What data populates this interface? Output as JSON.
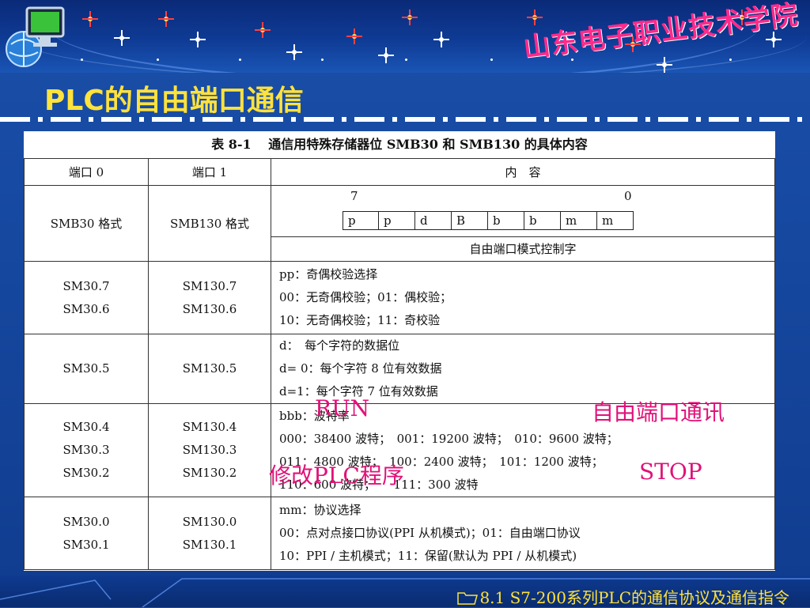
{
  "header": {
    "school_name": "山东电子职业技术学院",
    "title": "PLC的自由端口通信"
  },
  "table": {
    "caption": "表 8-1　 通信用特殊存储器位 SMB30 和 SMB130 的具体内容",
    "headers": [
      "端口 0",
      "端口 1",
      "内　容"
    ],
    "row1": {
      "c1": "SMB30 格式",
      "c2": "SMB130 格式",
      "bit_hi": "7",
      "bit_lo": "0",
      "bits": [
        "p",
        "p",
        "d",
        "B",
        "b",
        "b",
        "m",
        "m"
      ],
      "caption": "自由端口模式控制字"
    },
    "row2": {
      "c1": [
        "SM30.7",
        "SM30.6"
      ],
      "c2": [
        "SM130.7",
        "SM130.6"
      ],
      "content": [
        "pp：奇偶校验选择",
        "00：无奇偶校验；01：偶校验；",
        "10：无奇偶校验；11：奇校验"
      ]
    },
    "row3": {
      "c1": [
        "SM30.5"
      ],
      "c2": [
        "SM130.5"
      ],
      "content": [
        "d：　每个字符的数据位",
        "d= 0：每个字符 8 位有效数据",
        "d=1：每个字符 7 位有效数据"
      ]
    },
    "row4": {
      "c1": [
        "SM30.4",
        "SM30.3",
        "SM30.2"
      ],
      "c2": [
        "SM130.4",
        "SM130.3",
        "SM130.2"
      ],
      "content": [
        "bbb：波特率",
        "000：38400 波特；　001：19200 波特；　010：9600 波特；",
        "011：4800 波特；　100：2400 波特；　101：1200 波特；",
        "110：600 波特；　　111：300 波特"
      ]
    },
    "row5": {
      "c1": [
        "SM30.0",
        "SM30.1"
      ],
      "c2": [
        "SM130.0",
        "SM130.1"
      ],
      "content": [
        "mm：协议选择",
        "00：点对点接口协议(PPI 从机模式)；01：自由端口协议",
        "10：PPI / 主机模式；11：保留(默认为 PPI / 从机模式)"
      ]
    }
  },
  "annotations": {
    "run": "RUN",
    "free_port": "自由端口通讯",
    "modify_plc": "修改PLC程序",
    "stop": "STOP"
  },
  "footer": {
    "text": "8.1 S7-200系列PLC的通信协议及通信指令",
    "icon": "folder-icon"
  },
  "colors": {
    "title": "#ffe23c",
    "school": "#ff2a8a",
    "annotation": "#e01278",
    "background": "#1648a0"
  }
}
